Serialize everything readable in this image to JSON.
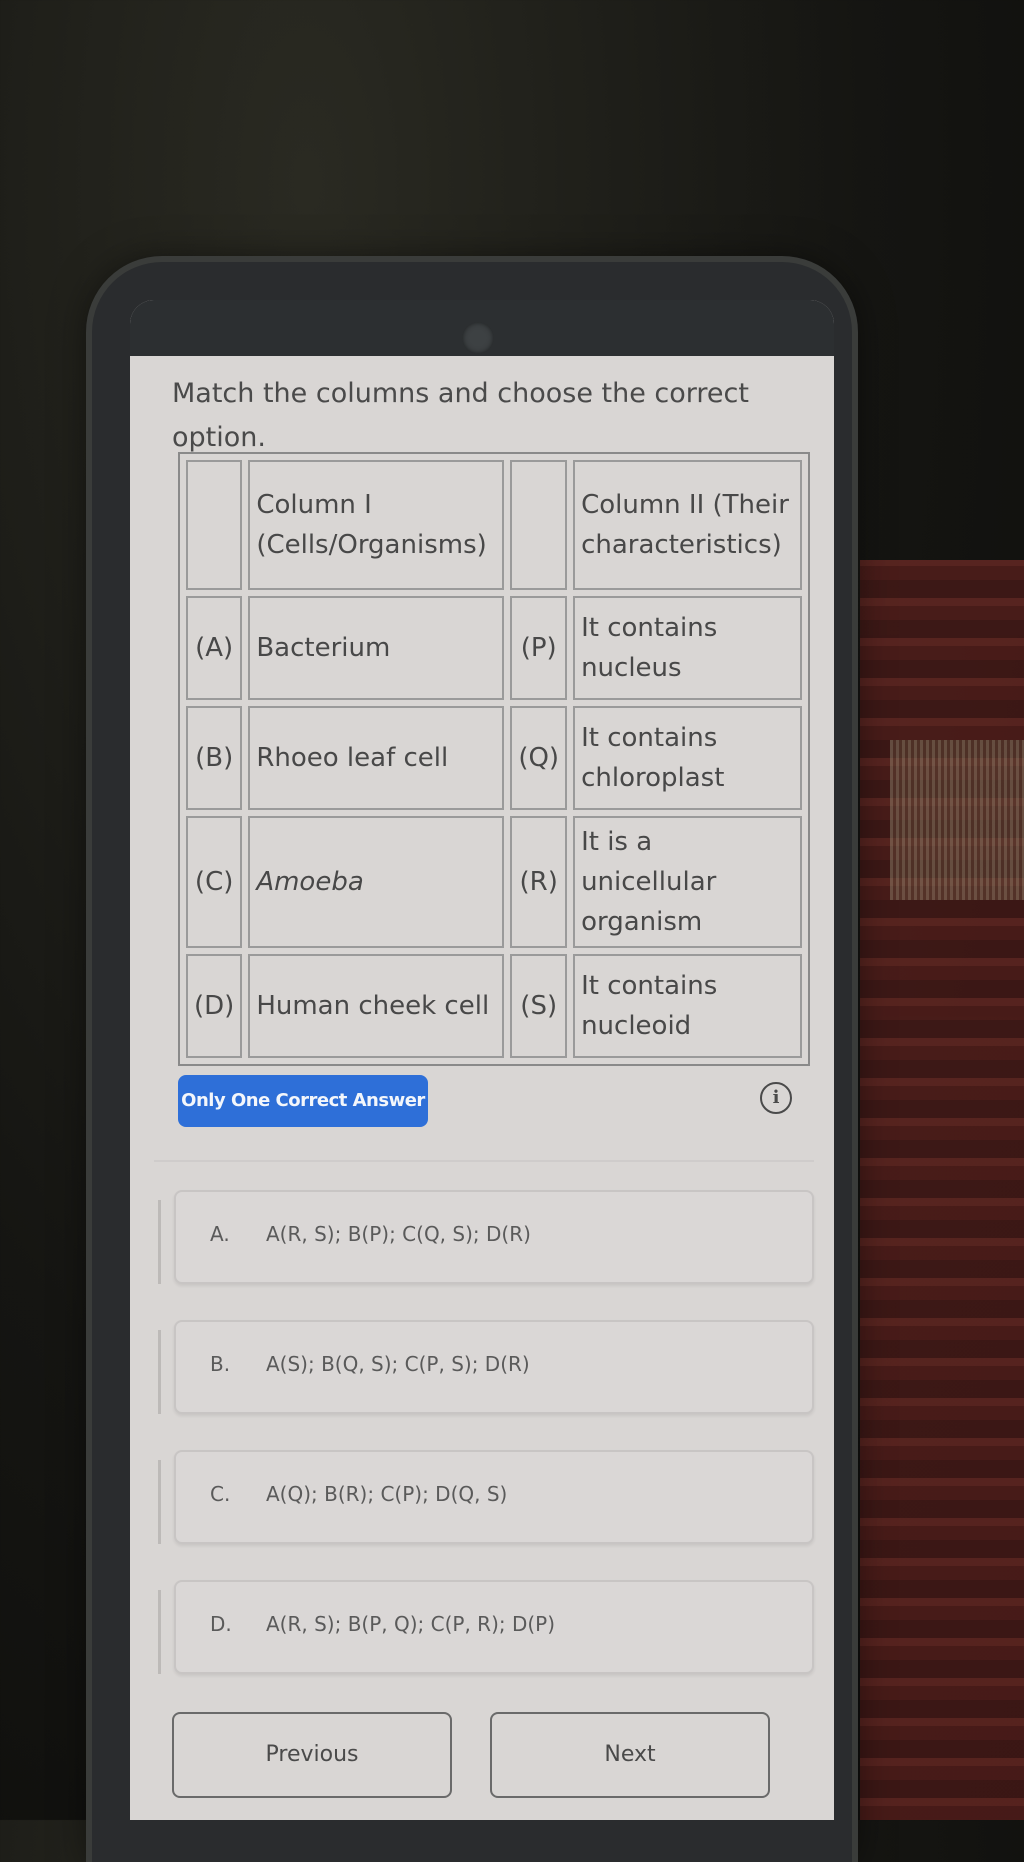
{
  "question": {
    "prompt": "Match the columns and choose the correct option.",
    "table": {
      "header": {
        "col1_key": "",
        "col1": "Column I (Cells/Organisms)",
        "col2_key": "",
        "col2": "Column II (Their characteristics)"
      },
      "rows": [
        {
          "key1": "(A)",
          "item": "Bacterium",
          "italic": false,
          "key2": "(P)",
          "characteristic": "It contains nucleus"
        },
        {
          "key1": "(B)",
          "item": "Rhoeo leaf cell",
          "italic": false,
          "key2": "(Q)",
          "characteristic": "It contains chloroplast"
        },
        {
          "key1": "(C)",
          "item": "Amoeba",
          "italic": true,
          "key2": "(R)",
          "characteristic": "It is a unicellular organism"
        },
        {
          "key1": "(D)",
          "item": "Human cheek cell",
          "italic": false,
          "key2": "(S)",
          "characteristic": "It contains nucleoid"
        }
      ]
    }
  },
  "badge": {
    "label": "Only One Correct Answer",
    "color": "#2e6fd8"
  },
  "info_icon": {
    "glyph": "i"
  },
  "options": [
    {
      "letter": "A.",
      "text": "A(R, S); B(P); C(Q, S); D(R)"
    },
    {
      "letter": "B.",
      "text": "A(S); B(Q, S); C(P, S); D(R)"
    },
    {
      "letter": "C.",
      "text": "A(Q); B(R); C(P); D(Q, S)"
    },
    {
      "letter": "D.",
      "text": "A(R, S); B(P, Q); C(P, R); D(P)"
    }
  ],
  "navigation": {
    "previous_label": "Previous",
    "next_label": "Next"
  }
}
